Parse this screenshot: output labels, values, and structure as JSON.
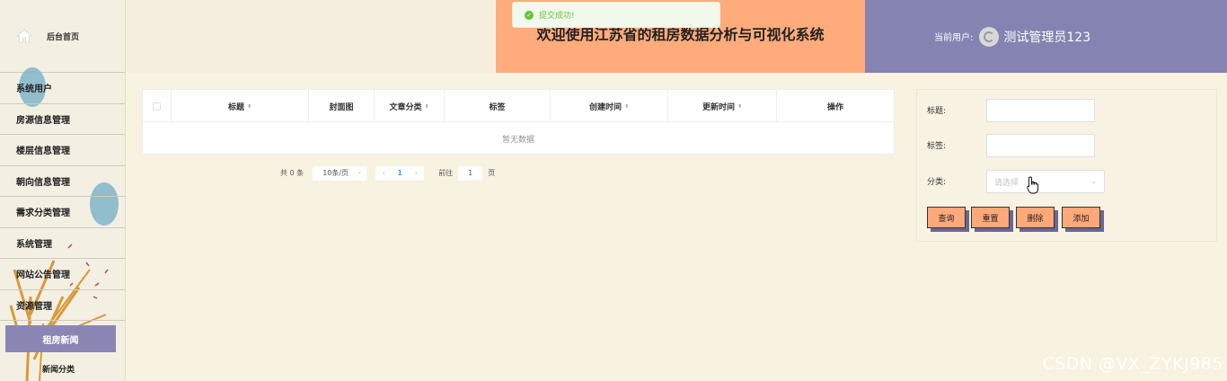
{
  "sidebar": {
    "home_label": "后台首页",
    "items": [
      {
        "label": "系统用户"
      },
      {
        "label": "房源信息管理"
      },
      {
        "label": "楼层信息管理"
      },
      {
        "label": "朝向信息管理"
      },
      {
        "label": "需求分类管理"
      },
      {
        "label": "系统管理"
      },
      {
        "label": "网站公告管理"
      },
      {
        "label": "资源管理"
      }
    ],
    "active_label": "租房新闻",
    "sub_label": "新闻分类"
  },
  "header": {
    "title": "欢迎使用江苏省的租房数据分析与可视化系统",
    "current_user_label": "当前用户:",
    "username": "测试管理员123"
  },
  "toast": {
    "message": "提交成功!",
    "color": "#67c23a"
  },
  "table": {
    "columns": [
      {
        "label": "标题",
        "sortable": true
      },
      {
        "label": "封面图",
        "sortable": false
      },
      {
        "label": "文章分类",
        "sortable": true
      },
      {
        "label": "标签",
        "sortable": false
      },
      {
        "label": "创建时间",
        "sortable": true
      },
      {
        "label": "更新时间",
        "sortable": true
      },
      {
        "label": "操作",
        "sortable": false
      }
    ],
    "empty_text": "暂无数据"
  },
  "pagination": {
    "total": "共 0 条",
    "page_size": "10条/页",
    "current_page": "1",
    "goto_label": "前往",
    "goto_value": "1",
    "page_suffix": "页"
  },
  "search": {
    "title_label": "标题:",
    "tag_label": "标签:",
    "category_label": "分类:",
    "category_placeholder": "请选择",
    "buttons": {
      "query": "查询",
      "reset": "重置",
      "delete": "删除",
      "add": "添加"
    }
  },
  "watermark": "CSDN @VX_ZYKJ985",
  "colors": {
    "header_orange": "#ffab7c",
    "header_purple": "#8583b2",
    "active_nav": "#8c86b4",
    "button": "#ffa87a",
    "button_shadow": "#6a6794"
  }
}
